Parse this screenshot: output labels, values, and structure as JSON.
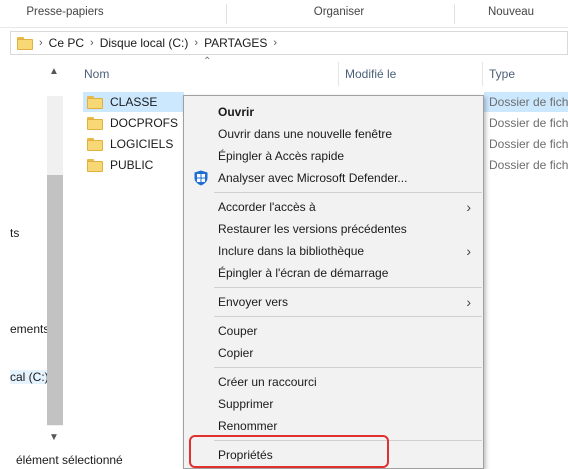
{
  "ribbon": {
    "groups": [
      "Presse-papiers",
      "Organiser",
      "Nouveau"
    ]
  },
  "address": {
    "crumbs": [
      "Ce PC",
      "Disque local (C:)",
      "PARTAGES"
    ]
  },
  "nav": {
    "items": [
      "ts",
      "ements",
      "cal (C:)"
    ]
  },
  "columns": {
    "name": "Nom",
    "modified": "Modifié le",
    "type": "Type"
  },
  "files": [
    {
      "name": "CLASSE",
      "type": "Dossier de fichiers",
      "selected": true
    },
    {
      "name": "DOCPROFS",
      "type": "Dossier de fichiers",
      "selected": false
    },
    {
      "name": "LOGICIELS",
      "type": "Dossier de fichiers",
      "selected": false
    },
    {
      "name": "PUBLIC",
      "type": "Dossier de fichiers",
      "selected": false
    }
  ],
  "status": {
    "text": "élément sélectionné"
  },
  "context_menu": {
    "items": [
      {
        "label": "Ouvrir"
      },
      {
        "label": "Ouvrir dans une nouvelle fenêtre"
      },
      {
        "label": "Épingler à Accès rapide"
      },
      {
        "label": "Analyser avec Microsoft Defender..."
      },
      {
        "label": "Accorder l'accès à"
      },
      {
        "label": "Restaurer les versions précédentes"
      },
      {
        "label": "Inclure dans la bibliothèque"
      },
      {
        "label": "Épingler à l'écran de démarrage"
      },
      {
        "label": "Envoyer vers"
      },
      {
        "label": "Couper"
      },
      {
        "label": "Copier"
      },
      {
        "label": "Créer un raccourci"
      },
      {
        "label": "Supprimer"
      },
      {
        "label": "Renommer"
      },
      {
        "label": "Propriétés"
      }
    ],
    "submenu_arrow": "›"
  },
  "icons": {
    "folder": "folder-icon",
    "defender": "shield-icon",
    "highlight_color": "#e03030",
    "selection_color": "#cce8ff"
  }
}
